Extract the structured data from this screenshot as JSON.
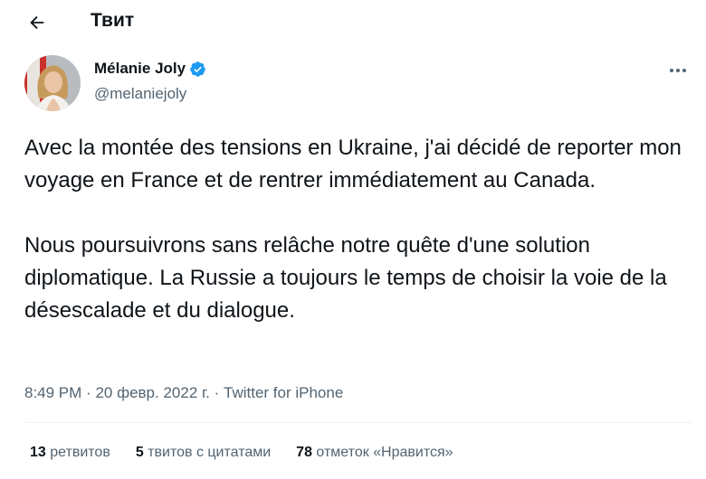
{
  "header": {
    "title": "Твит",
    "back_icon": "back-arrow-icon"
  },
  "author": {
    "name": "Mélanie Joly",
    "handle": "@melaniejoly",
    "verified_icon": "verified-badge-icon",
    "verified_color": "#1d9bf0",
    "more_icon": "more-horizontal-icon"
  },
  "tweet": {
    "paragraphs": [
      "Avec la montée des tensions en Ukraine, j'ai décidé de reporter mon voyage en France et de rentrer immédiatement au Canada.",
      "Nous poursuivrons sans relâche notre quête d'une solution diplomatique. La Russie a toujours le temps de choisir la voie de la désescalade et du dialogue."
    ]
  },
  "meta": {
    "time": "8:49 PM",
    "separator": "·",
    "date": "20 февр. 2022 г.",
    "source": "Twitter for iPhone"
  },
  "stats": {
    "retweets_count": "13",
    "retweets_label": "ретвитов",
    "quotes_count": "5",
    "quotes_label": "твитов с цитатами",
    "likes_count": "78",
    "likes_label": "отметок «Нравится»"
  },
  "colors": {
    "text_primary": "#0f1419",
    "text_secondary": "#536471",
    "accent": "#1d9bf0",
    "divider": "#eff3f4"
  }
}
